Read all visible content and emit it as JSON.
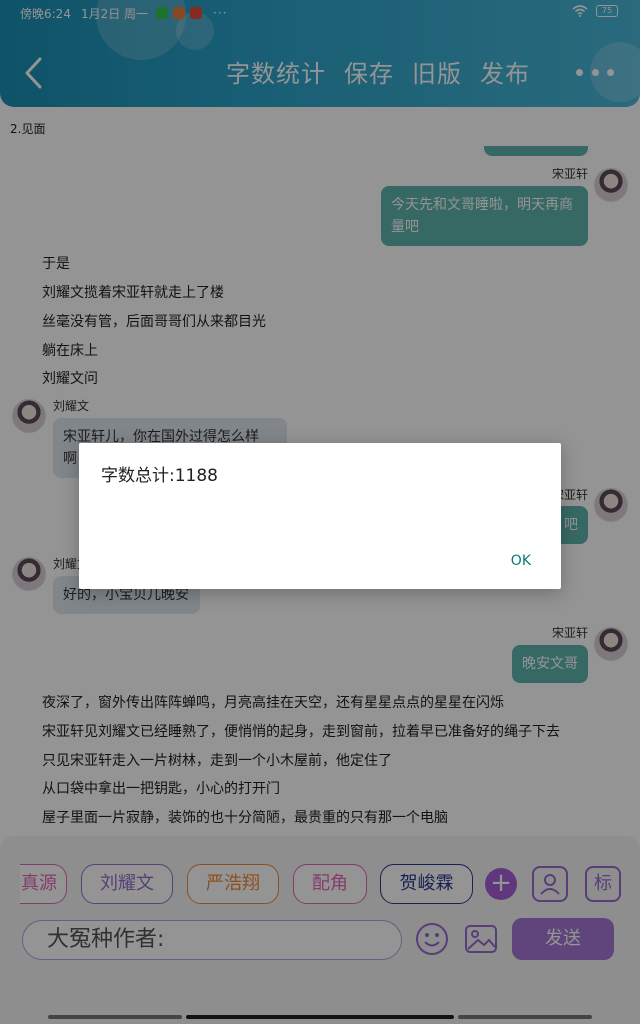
{
  "status_bar": {
    "time": "傍晚6:24",
    "date": "1月2日 周一",
    "dots": "···",
    "battery": "75"
  },
  "header": {
    "toolbar": [
      {
        "label": "字数统计",
        "name": "word-count-button"
      },
      {
        "label": "保存",
        "name": "save-button"
      },
      {
        "label": "旧版",
        "name": "old-version-button"
      },
      {
        "label": "发布",
        "name": "publish-button"
      }
    ]
  },
  "chapter_title": "2.见面",
  "messages": {
    "r1": {
      "sender": "宋亚轩",
      "text_line1": "今天先和文哥睡啦，明天再商",
      "text_line2": "量吧"
    },
    "narration1": [
      "于是",
      "刘耀文揽着宋亚轩就走上了楼",
      "丝毫没有管，后面哥哥们从来都目光",
      "躺在床上",
      "刘耀文问"
    ],
    "l1": {
      "sender": "刘耀文",
      "text_line1": "宋亚轩儿，你在国外过得怎么样",
      "text_line2": "啊"
    },
    "r2": {
      "sender": "宋亚轩",
      "text_tail": "吧"
    },
    "l2": {
      "sender": "刘耀文",
      "text": "好的，小宝贝儿晚安"
    },
    "r3": {
      "sender": "宋亚轩",
      "text": "晚安文哥"
    },
    "narration2": [
      "夜深了，窗外传出阵阵蝉鸣，月亮高挂在天空，还有星星点点的星星在闪烁",
      "宋亚轩见刘耀文已经睡熟了，便悄悄的起身，走到窗前，拉着早已准备好的绳子下去",
      "只见宋亚轩走入一片树林，走到一个小木屋前，他定住了",
      "从口袋中拿出一把钥匙，小心的打开门",
      "屋子里面一片寂静，装饰的也十分简陋，最贵重的只有那一个电脑"
    ]
  },
  "bottom": {
    "chips": [
      "真源",
      "刘耀文",
      "严浩翔",
      "配角",
      "贺峻霖"
    ],
    "plus": "+",
    "tag_button": "标",
    "author_placeholder": "大冤种作者:",
    "send": "发送"
  },
  "dialog": {
    "message": "字数总计:1188",
    "ok": "OK"
  },
  "colors": {
    "header": "#2ba3c9",
    "bubble_right": "#5fb5ad",
    "bubble_left": "#dfe7ee",
    "send": "#a677d6",
    "dialog_ok": "#0b7a76"
  }
}
